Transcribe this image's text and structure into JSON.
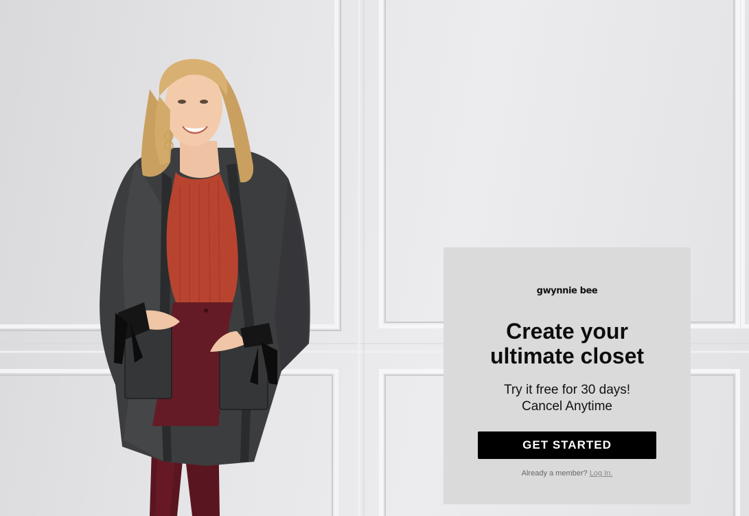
{
  "hero": {
    "image_alt": "Model wearing a gray open-front cardigan with tie-bow pockets, rust ribbed sweater and burgundy pants"
  },
  "card": {
    "logo_text": "gwynnie bee",
    "headline_line1": "Create your",
    "headline_line2": "ultimate closet",
    "subline1": "Try it free for 30 days!",
    "subline2": "Cancel Anytime",
    "cta_label": "GET STARTED",
    "member_prompt": "Already a member?",
    "login_link": "Log In."
  },
  "colors": {
    "cta_bg": "#000000",
    "cta_text": "#ffffff",
    "card_bg": "#dadada",
    "wall": "#e6e6e8"
  }
}
